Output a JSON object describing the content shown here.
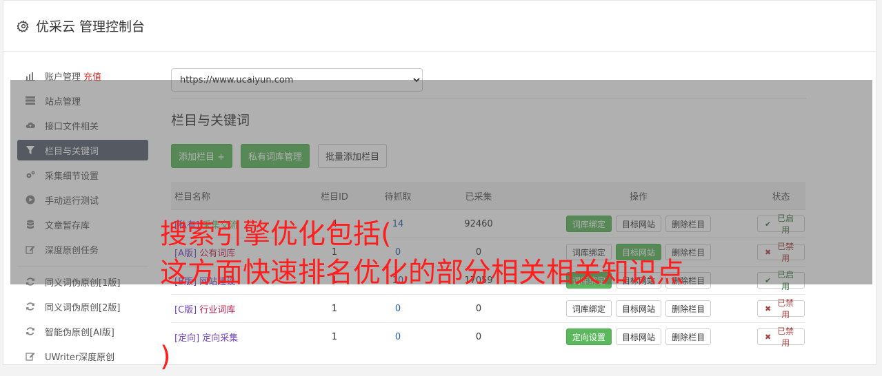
{
  "header": {
    "title": "优采云 管理控制台",
    "icon": "gear-icon"
  },
  "sidebar": {
    "items": [
      {
        "label": "账户管理",
        "extra": "充值",
        "icon": "bar-chart-icon"
      },
      {
        "label": "站点管理",
        "icon": "server-icon"
      },
      {
        "label": "接口文件相关",
        "icon": "cloud-upload-icon"
      },
      {
        "label": "栏目与关键词",
        "icon": "filter-icon",
        "active": true
      },
      {
        "label": "采集细节设置",
        "icon": "cogs-icon"
      },
      {
        "label": "手动运行测试",
        "icon": "play-circle-icon"
      },
      {
        "label": "文章暂存库",
        "icon": "database-icon"
      },
      {
        "label": "深度原创任务",
        "icon": "edit-icon"
      },
      {
        "label": "同义词伪原创[1版]",
        "icon": "refresh-icon"
      },
      {
        "label": "同义词伪原创[2版]",
        "icon": "refresh-icon"
      },
      {
        "label": "智能伪原创[AI版]",
        "icon": "refresh-icon"
      },
      {
        "label": "UWriter深度原创",
        "icon": "edit-icon"
      }
    ]
  },
  "site_select": {
    "value": "https://www.ucaiyun.com"
  },
  "section": {
    "title": "栏目与关键词"
  },
  "buttons": {
    "add_column": "添加栏目 +",
    "private_lib": "私有词库管理",
    "batch_add": "批量添加栏目"
  },
  "table": {
    "headers": [
      "栏目名称",
      "栏目ID",
      "待抓取",
      "已采集",
      "操作",
      "状态"
    ],
    "rows": [
      {
        "prefix": "[私有]",
        "name": "采集交流",
        "id": "4",
        "pending": "14",
        "collected": "92460",
        "ops": [
          "词库绑定",
          "目标网站",
          "删除栏目"
        ],
        "status": "已启用"
      },
      {
        "prefix": "[A版]",
        "name": "公有词库",
        "id": "1",
        "pending": "0",
        "collected": "0",
        "ops": [
          "词库绑定",
          "目标网站",
          "删除栏目"
        ],
        "status": "已禁用"
      },
      {
        "prefix": "[B版]",
        "name": "网站建设",
        "id": "1",
        "pending": "10",
        "collected": "17059",
        "ops": [
          "词库绑定",
          "目标网站",
          "删除栏目"
        ],
        "status": "已启用"
      },
      {
        "prefix": "[C版]",
        "name": "行业词库",
        "id": "1",
        "pending": "0",
        "collected": "0",
        "ops": [
          "词库绑定",
          "目标网站",
          "删除栏目"
        ],
        "status": "已禁用"
      },
      {
        "prefix": "[定向]",
        "name": "定向采集",
        "id": "1",
        "pending": "0",
        "collected": "0",
        "ops": [
          "定向设置",
          "目标网站",
          "删除栏目"
        ],
        "status": "已禁用"
      }
    ]
  },
  "promo": {
    "line1": "搜索引擎优化包括(",
    "line2": "这方面快速排名优化的部分相关相关知识点",
    "line3": ")"
  },
  "colors": {
    "primary_green": "#5cb85c",
    "active_nav": "#5a6270",
    "promo_red": "#ff1e1e"
  }
}
